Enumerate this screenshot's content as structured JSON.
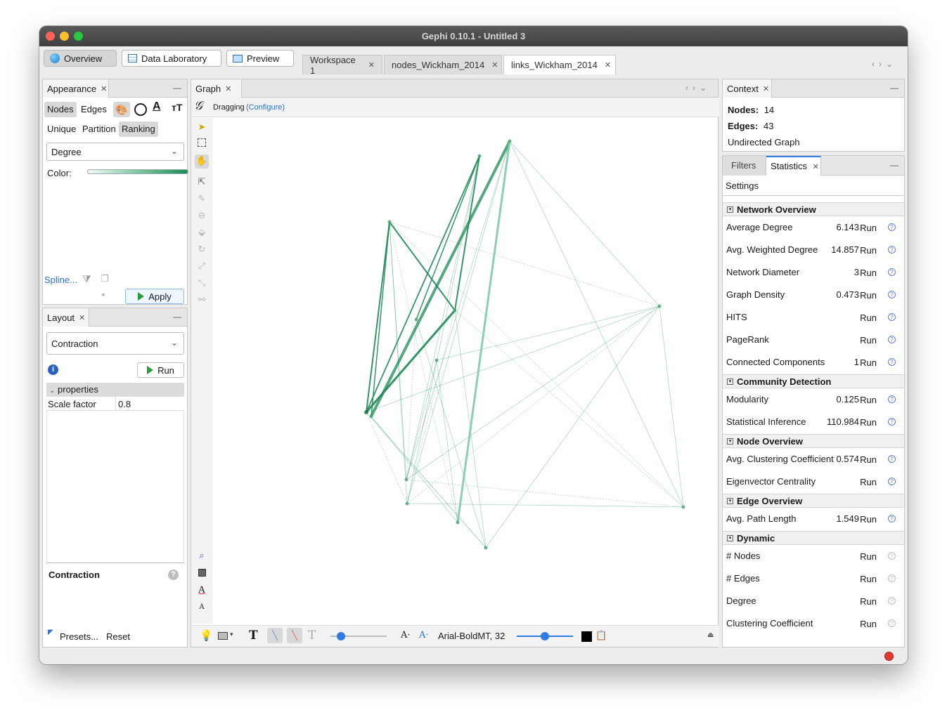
{
  "window": {
    "title": "Gephi 0.10.1 - Untitled 3"
  },
  "toolbar": {
    "overview": "Overview",
    "data_laboratory": "Data Laboratory",
    "preview": "Preview"
  },
  "workspace_tabs": [
    "Workspace 1",
    "nodes_Wickham_2014",
    "links_Wickham_2014"
  ],
  "appearance": {
    "title": "Appearance",
    "tabs": [
      "Nodes",
      "Edges"
    ],
    "modes": [
      "Unique",
      "Partition",
      "Ranking"
    ],
    "attribute": "Degree",
    "color_label": "Color:",
    "spline": "Spline...",
    "apply": "Apply"
  },
  "layout": {
    "title": "Layout",
    "algorithm": "Contraction",
    "run": "Run",
    "properties_header": "properties",
    "property_name": "Scale factor",
    "property_value": "0.8",
    "desc_title": "Contraction",
    "presets": "Presets...",
    "reset": "Reset"
  },
  "graph": {
    "title": "Graph",
    "mode": "Dragging",
    "configure": "(Configure)",
    "font_label": "Arial-BoldMT, 32",
    "edge_color": "#1e8a55",
    "node_color": "#4f9f78"
  },
  "context": {
    "title": "Context",
    "nodes_label": "Nodes:",
    "nodes_value": "14",
    "edges_label": "Edges:",
    "edges_value": "43",
    "graph_type": "Undirected Graph"
  },
  "statistics": {
    "filters_tab": "Filters",
    "stats_tab": "Statistics",
    "settings": "Settings",
    "run_label": "Run",
    "sections": [
      {
        "title": "Network Overview",
        "rows": [
          {
            "name": "Average Degree",
            "value": "6.143"
          },
          {
            "name": "Avg. Weighted Degree",
            "value": "14.857"
          },
          {
            "name": "Network Diameter",
            "value": "3"
          },
          {
            "name": "Graph Density",
            "value": "0.473"
          },
          {
            "name": "HITS",
            "value": ""
          },
          {
            "name": "PageRank",
            "value": ""
          },
          {
            "name": "Connected Components",
            "value": "1"
          }
        ]
      },
      {
        "title": "Community Detection",
        "rows": [
          {
            "name": "Modularity",
            "value": "0.125"
          },
          {
            "name": "Statistical Inference",
            "value": "110.984"
          }
        ]
      },
      {
        "title": "Node Overview",
        "rows": [
          {
            "name": "Avg. Clustering Coefficient",
            "value": "0.574"
          },
          {
            "name": "Eigenvector Centrality",
            "value": ""
          }
        ]
      },
      {
        "title": "Edge Overview",
        "rows": [
          {
            "name": "Avg. Path Length",
            "value": "1.549"
          }
        ]
      },
      {
        "title": "Dynamic",
        "rows": [
          {
            "name": "# Nodes",
            "value": ""
          },
          {
            "name": "# Edges",
            "value": ""
          },
          {
            "name": "Degree",
            "value": ""
          },
          {
            "name": "Clustering Coefficient",
            "value": ""
          }
        ]
      }
    ]
  }
}
